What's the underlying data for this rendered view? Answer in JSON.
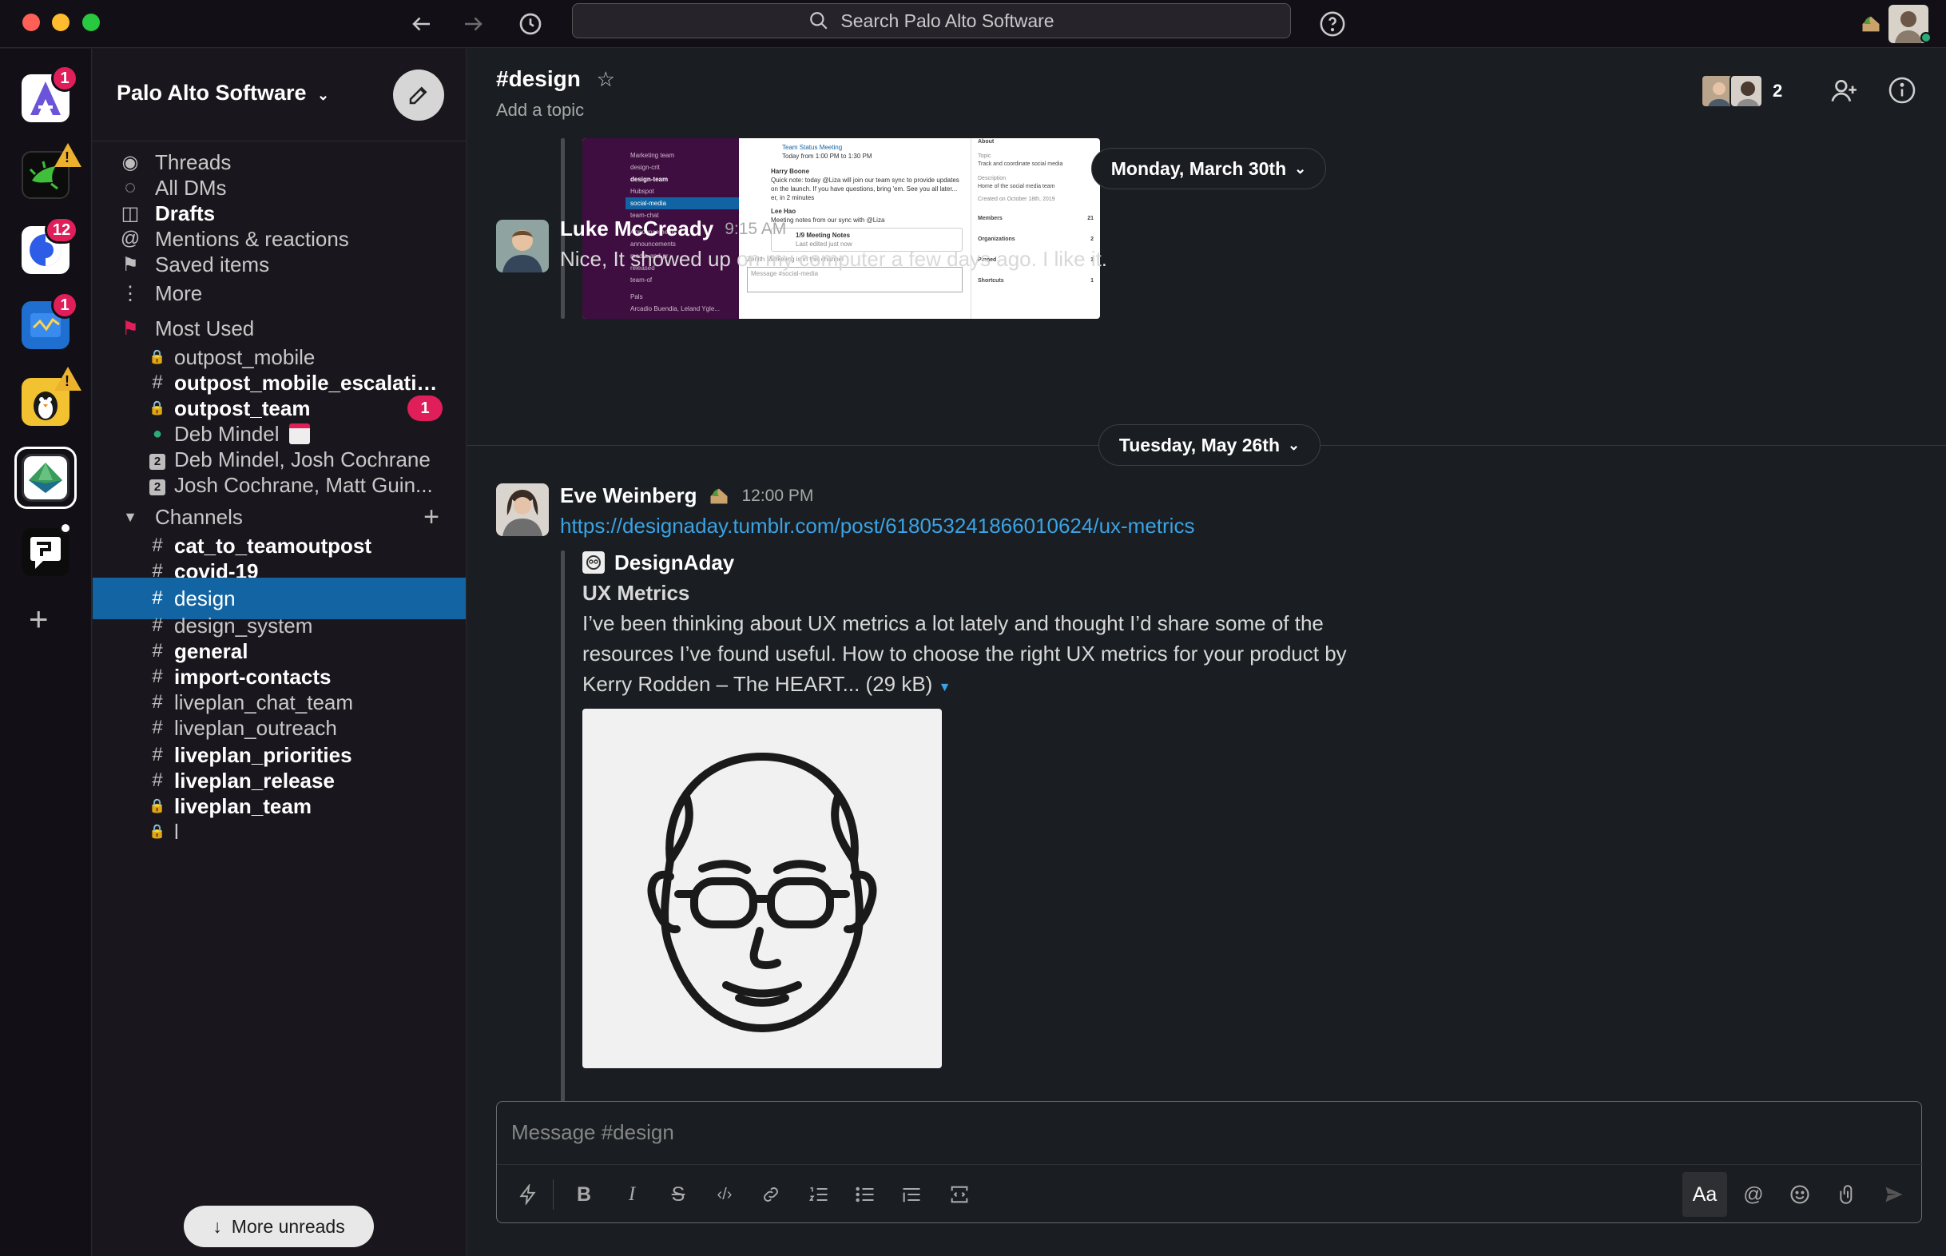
{
  "titlebar": {
    "search_placeholder": "Search Palo Alto Software",
    "back_icon": "arrow-left-icon",
    "forward_icon": "arrow-right-icon",
    "history_icon": "clock-icon",
    "help_icon": "question-icon"
  },
  "rail": {
    "workspaces": [
      {
        "name": "A",
        "badge": "1",
        "color": "#5b4bd8"
      },
      {
        "name": "bug",
        "badge": "",
        "warning": "!",
        "color": "#111"
      },
      {
        "name": "circle",
        "badge": "12",
        "color": "#2d5ce6"
      },
      {
        "name": "blue",
        "badge": "1",
        "color": "#1f6fd1"
      },
      {
        "name": "penguin",
        "badge": "",
        "warning": "!",
        "color": "#f2c230"
      },
      {
        "name": "liveplan",
        "badge": "",
        "color": "#2c2f33"
      },
      {
        "name": "chat",
        "badge": "",
        "color": "#111"
      }
    ],
    "add_label": "+"
  },
  "sidebar": {
    "team_name": "Palo Alto Software",
    "nav": [
      {
        "icon": "threads-icon",
        "glyph": "◉",
        "label": "Threads"
      },
      {
        "icon": "dms-icon",
        "glyph": "◌",
        "label": "All DMs"
      },
      {
        "icon": "drafts-icon",
        "glyph": "◫",
        "label": "Drafts"
      },
      {
        "icon": "mentions-icon",
        "glyph": "@",
        "label": "Mentions & reactions"
      },
      {
        "icon": "bookmark-icon",
        "glyph": "⚑",
        "label": "Saved items"
      },
      {
        "icon": "more-icon",
        "glyph": "⋮",
        "label": "More"
      }
    ],
    "most_used_label": "Most Used",
    "most_used": [
      {
        "glyph": "🔒",
        "label": "outpost_mobile",
        "bold": false,
        "badge": ""
      },
      {
        "glyph": "#",
        "label": "outpost_mobile_escalatio...",
        "bold": true,
        "badge": ""
      },
      {
        "glyph": "🔒",
        "label": "outpost_team",
        "bold": true,
        "badge": "1"
      },
      {
        "glyph": "●",
        "label": "Deb Mindel",
        "bold": false,
        "badge": ""
      },
      {
        "glyph": "2",
        "label": "Deb Mindel, Josh Cochrane",
        "bold": false,
        "badge": ""
      },
      {
        "glyph": "2",
        "label": "Josh Cochrane, Matt Guin...",
        "bold": false,
        "badge": ""
      }
    ],
    "channels_label": "Channels",
    "channels": [
      {
        "glyph": "#",
        "label": "cat_to_teamoutpost",
        "bold": true
      },
      {
        "glyph": "#",
        "label": "covid-19",
        "bold": true
      },
      {
        "glyph": "#",
        "label": "design",
        "bold": false,
        "selected": true
      },
      {
        "glyph": "#",
        "label": "design_system",
        "bold": false
      },
      {
        "glyph": "#",
        "label": "general",
        "bold": true
      },
      {
        "glyph": "#",
        "label": "import-contacts",
        "bold": true
      },
      {
        "glyph": "#",
        "label": "liveplan_chat_team",
        "bold": false
      },
      {
        "glyph": "#",
        "label": "liveplan_outreach",
        "bold": false
      },
      {
        "glyph": "#",
        "label": "liveplan_priorities",
        "bold": true
      },
      {
        "glyph": "#",
        "label": "liveplan_release",
        "bold": true
      },
      {
        "glyph": "🔒",
        "label": "liveplan_team",
        "bold": true
      },
      {
        "glyph": "🔒",
        "label": "l",
        "bold": false
      }
    ],
    "more_unreads": "More unreads"
  },
  "channel": {
    "name": "#design",
    "topic": "Add a topic",
    "member_count": "2"
  },
  "messages": {
    "date1": "Monday, March 30th",
    "luke_name": "Luke McCready",
    "luke_time": "9:15 AM",
    "luke_text": "Nice, It showed up on my computer a few days ago. I like it.",
    "date2": "Tuesday, May 26th",
    "eve_name": "Eve Weinberg",
    "eve_time": "12:00 PM",
    "eve_link": "https://designaday.tumblr.com/post/618053241866010624/ux-metrics",
    "unfurl_site": "DesignAday",
    "unfurl_title": "UX Metrics",
    "unfurl_line1": "I’ve been thinking about UX metrics a lot lately and thought I’d share some of the",
    "unfurl_line2": "resources I’ve found useful. How to choose the right UX metrics for your product by",
    "unfurl_line3": "Kerry Rodden – The HEART... (29 kB)"
  },
  "screenshot_preview": {
    "sidebar_items": [
      "Marketing team",
      "design-crit",
      "design-team",
      "Hubspot",
      "social-media",
      "team-chat",
      "Announcements",
      "announcements",
      "media-and-pr",
      "released",
      "team-of",
      "Pals",
      "Arcadio Buendia, Leland Ygle..."
    ],
    "msgs": [
      "Team Status Meeting",
      "Today from 1:00 PM to 1:30 PM",
      "Harry Boone",
      "Quick note: today @Liza will join our team sync to provide updates on the launch. If you have questions, bring 'em. See you all later... er, in 2 minutes",
      "Lee Hao",
      "Meeting notes from our sync with @Liza",
      "1/9 Meeting Notes",
      "Last edited just now",
      "Zenith Marketing is in this channel",
      "Message #social-media"
    ],
    "about": [
      "About",
      "Topic",
      "Track and coordinate social media",
      "Description",
      "Home of the social media team",
      "Created on October 18th, 2019",
      "Members",
      "21",
      "Organizations",
      "2",
      "Pinned",
      "1",
      "Shortcuts",
      "1"
    ]
  },
  "composer": {
    "placeholder": "Message #design",
    "format_label": "Aa"
  },
  "colors": {
    "accent": "#1264a3",
    "link": "#3aa3e3",
    "badge": "#e01e5a",
    "warning": "#ecb22e"
  }
}
